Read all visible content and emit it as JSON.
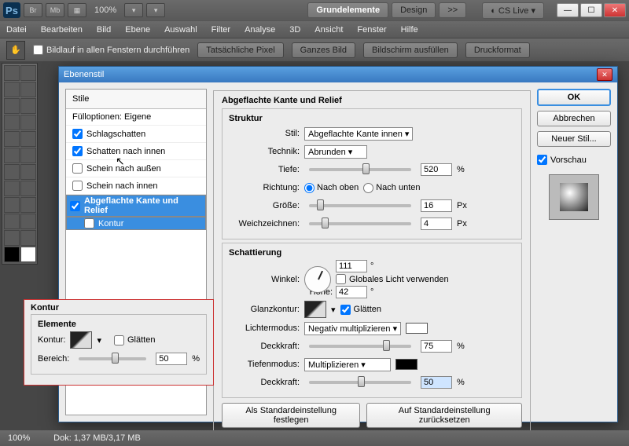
{
  "app": {
    "logo": "Ps",
    "mb1": "Br",
    "mb2": "Mb",
    "zoom": "100%"
  },
  "workspace": {
    "btn1": "Grundelemente",
    "btn2": "Design",
    "more": ">>",
    "cs": "CS Live"
  },
  "menu": {
    "datei": "Datei",
    "bearb": "Bearbeiten",
    "bild": "Bild",
    "ebene": "Ebene",
    "auswahl": "Auswahl",
    "filter": "Filter",
    "analyse": "Analyse",
    "d3": "3D",
    "ansicht": "Ansicht",
    "fenster": "Fenster",
    "hilfe": "Hilfe"
  },
  "optbar": {
    "scrollall": "Bildlauf in allen Fenstern durchführen",
    "actual": "Tatsächliche Pixel",
    "fit": "Ganzes Bild",
    "fill": "Bildschirm ausfüllen",
    "print": "Druckformat"
  },
  "dlg": {
    "title": "Ebenenstil",
    "styles_hdr": "Stile",
    "blend": "Fülloptionen: Eigene",
    "drop": "Schlagschatten",
    "inner": "Schatten nach innen",
    "oglow": "Schein nach außen",
    "iglow": "Schein nach innen",
    "bevel": "Abgeflachte Kante und Relief",
    "contour": "Kontur",
    "contour2": "Kontur",
    "section": "Abgeflachte Kante und Relief",
    "struct": "Struktur",
    "stil_l": "Stil:",
    "stil_v": "Abgeflachte Kante innen",
    "tech_l": "Technik:",
    "tech_v": "Abrunden",
    "tiefe_l": "Tiefe:",
    "tiefe_v": "520",
    "pct": "%",
    "richt_l": "Richtung:",
    "r_up": "Nach oben",
    "r_dn": "Nach unten",
    "groesse_l": "Größe:",
    "groesse_v": "16",
    "px": "Px",
    "weich_l": "Weichzeichnen:",
    "weich_v": "4",
    "shade": "Schattierung",
    "winkel_l": "Winkel:",
    "winkel_v": "111",
    "deg": "°",
    "glob": "Globales Licht verwenden",
    "hoehe_l": "Höhe:",
    "hoehe_v": "42",
    "glanz_l": "Glanzkontur:",
    "glaetten": "Glätten",
    "licht_l": "Lichtermodus:",
    "licht_v": "Negativ multiplizieren",
    "deck_l": "Deckkraft:",
    "deck1": "75",
    "tiefm_l": "Tiefenmodus:",
    "tiefm_v": "Multiplizieren",
    "deck2": "50",
    "def": "Als Standardeinstellung festlegen",
    "reset": "Auf Standardeinstellung zurücksetzen",
    "ok": "OK",
    "cancel": "Abbrechen",
    "new": "Neuer Stil...",
    "prev": "Vorschau"
  },
  "popup": {
    "title": "Kontur",
    "elem": "Elemente",
    "kontur": "Kontur:",
    "glaetten": "Glätten",
    "bereich": "Bereich:",
    "val": "50",
    "pct": "%"
  },
  "status": {
    "zoom": "100%",
    "doc": "Dok: 1,37 MB/3,17 MB"
  }
}
